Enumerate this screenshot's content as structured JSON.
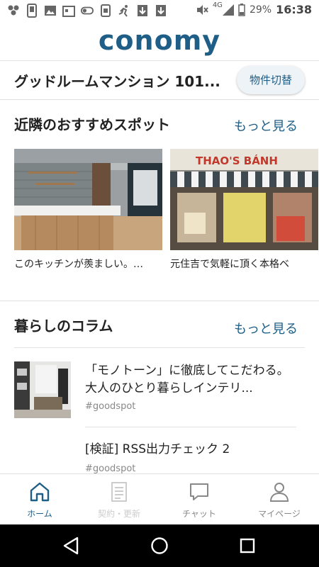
{
  "status_bar": {
    "network": "4G",
    "battery": "29%",
    "time": "16:38"
  },
  "app": {
    "logo_text": "conomy"
  },
  "property": {
    "name": "グッドルームマンション 101...",
    "switch_label": "物件切替"
  },
  "spots": {
    "title": "近隣のおすすめスポット",
    "more_label": "もっと見る",
    "cards": [
      {
        "caption": "このキッチンが羨ましい。…"
      },
      {
        "caption": "元住吉で気軽に頂く本格ベ",
        "sign_text": "THAO'S BÁNH"
      }
    ]
  },
  "columns": {
    "title": "暮らしのコラム",
    "more_label": "もっと見る",
    "items": [
      {
        "title": "「モノトーン」に徹底してこだわる。大人のひとり暮らしインテリ...",
        "tag": "#goodspot"
      },
      {
        "title": "[検証] RSS出力チェック 2",
        "tag": "#goodspot"
      }
    ]
  },
  "bottom_nav": {
    "items": [
      {
        "label": "ホーム",
        "icon": "home-icon",
        "state": "active"
      },
      {
        "label": "契約・更新",
        "icon": "document-icon",
        "state": "disabled"
      },
      {
        "label": "チャット",
        "icon": "chat-icon",
        "state": "normal"
      },
      {
        "label": "マイページ",
        "icon": "person-icon",
        "state": "normal"
      }
    ]
  },
  "colors": {
    "brand": "#1f5e86",
    "nav_active": "#1f5e86",
    "nav_inactive": "#888888",
    "nav_disabled": "#cccccc"
  }
}
